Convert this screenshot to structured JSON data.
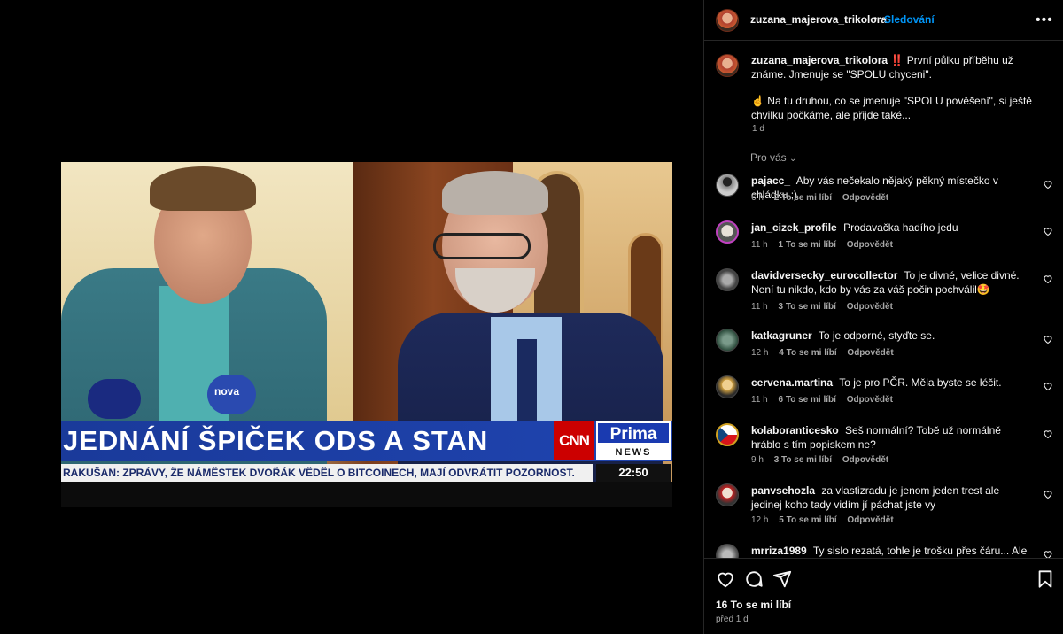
{
  "media": {
    "headline": "JEDNÁNÍ ŠPIČEK ODS A STAN",
    "ticker": "RAKUŠAN: ZPRÁVY, ŽE NÁMĚSTEK DVOŘÁK VĚDĚL O BITCOINECH, MAJÍ ODVRÁTIT POZORNOST.",
    "cnn_label": "CNN",
    "prima_label": "Prima",
    "news_label": "NEWS",
    "clock": "22:50",
    "mic_label": "nova"
  },
  "header": {
    "username": "zuzana_majerova_trikolora",
    "dot": "•",
    "follow_label": "Sledování",
    "more_icon": "more-horizontal-icon"
  },
  "caption": {
    "username": "zuzana_majerova_trikolora",
    "line1": "‼️ První půlku příběhu už známe. Jmenuje se \"SPOLU chyceni\".",
    "line2": "☝️ Na tu druhou, co se jmenuje \"SPOLU pověšení\", si ještě chvilku počkáme, ale přijde také...",
    "time": "1 d"
  },
  "for_you_label": "Pro vás",
  "comments": [
    {
      "user": "pajacc_",
      "text": "Aby vás nečekalo nějaký pěkný místečko v chládku ;)",
      "time": "6 h",
      "likes": "2 To se mi líbí",
      "reply": "Odpovědět"
    },
    {
      "user": "jan_cizek_profile",
      "text": "Prodavačka hadího jedu",
      "time": "11 h",
      "likes": "1 To se mi líbí",
      "reply": "Odpovědět"
    },
    {
      "user": "davidversecky_eurocollector",
      "text": "To je divné, velice divné. Není tu nikdo, kdo by vás za váš počin pochválil🤩",
      "time": "11 h",
      "likes": "3 To se mi líbí",
      "reply": "Odpovědět"
    },
    {
      "user": "katkagruner",
      "text": "To je odporné, styďte se.",
      "time": "12 h",
      "likes": "4 To se mi líbí",
      "reply": "Odpovědět"
    },
    {
      "user": "cervena.martina",
      "text": "To je pro PČR. Měla byste se léčit.",
      "time": "11 h",
      "likes": "6 To se mi líbí",
      "reply": "Odpovědět"
    },
    {
      "user": "kolaboranticesko",
      "text": "Seš normální? Tobě už normálně hráblo s tím popiskem ne?",
      "time": "9 h",
      "likes": "3 To se mi líbí",
      "reply": "Odpovědět"
    },
    {
      "user": "panvsehozla",
      "text": "za vlastizradu je jenom jeden trest ale jedinej koho tady vidím jí páchat jste vy",
      "time": "12 h",
      "likes": "5 To se mi líbí",
      "reply": "Odpovědět"
    },
    {
      "user": "mrriza1989",
      "text": "Ty sislo rezatá, tohle je trošku přes čáru... Ale co by",
      "time": "",
      "likes": "",
      "reply": ""
    }
  ],
  "footer": {
    "likes": "16 To se mi líbí",
    "time": "před 1 d"
  },
  "colors": {
    "accent": "#0095f6",
    "panel_bg": "#000000",
    "text_primary": "#f5f5f5",
    "text_secondary": "#a8a8a8",
    "divider": "#262626"
  }
}
